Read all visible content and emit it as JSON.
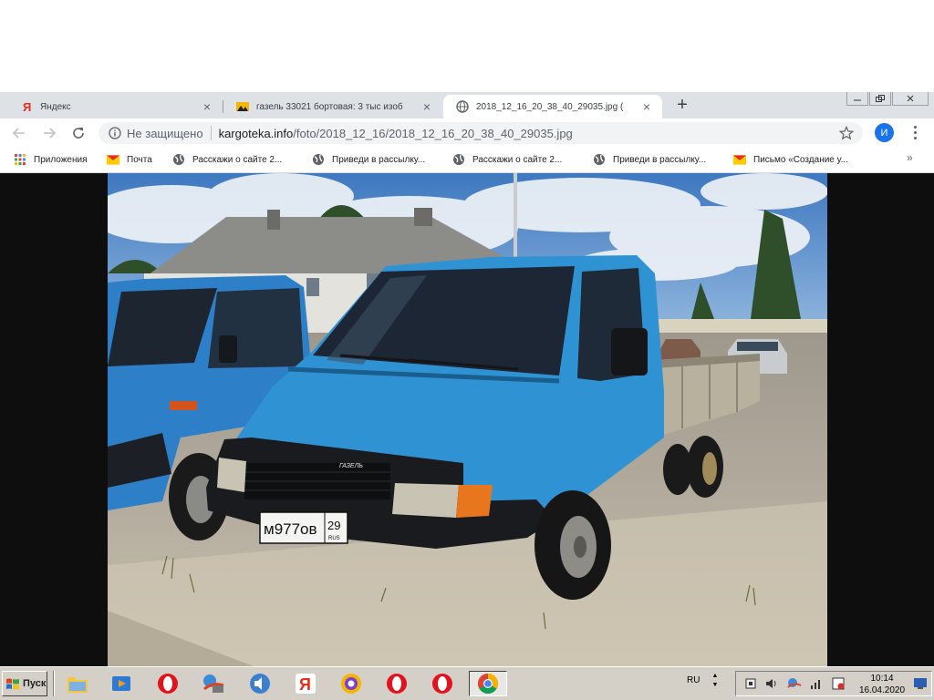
{
  "browser": {
    "tabs": [
      {
        "title": "Яндекс",
        "icon": "yandex-icon"
      },
      {
        "title": "газель 33021 бортовая: 3 тыс изоб",
        "icon": "image-site-icon"
      },
      {
        "title": "2018_12_16_20_38_40_29035.jpg (",
        "icon": "globe-icon"
      }
    ],
    "new_tab": "+",
    "security_label": "Не защищено",
    "url_host": "kargoteka.info",
    "url_path": "/foto/2018_12_16/2018_12_16_20_38_40_29035.jpg",
    "profile_initial": "И",
    "bookmarks": [
      {
        "label": "Приложения",
        "icon": "apps-grid-icon"
      },
      {
        "label": "Почта",
        "icon": "mail-icon"
      },
      {
        "label": "Расскажи о сайте 2...",
        "icon": "globe-icon"
      },
      {
        "label": "Приведи в рассылку...",
        "icon": "globe-icon"
      },
      {
        "label": "Расскажи о сайте 2...",
        "icon": "globe-icon"
      },
      {
        "label": "Приведи в рассылку...",
        "icon": "globe-icon"
      },
      {
        "label": "Письмо «Создание у...",
        "icon": "mail-icon"
      }
    ],
    "bookmarks_overflow": "»"
  },
  "photo": {
    "plate_number": "м977ов",
    "plate_region": "29",
    "plate_country": "RUS",
    "grille_badge": "ГАЗЕЛЬ"
  },
  "taskbar": {
    "start_label": "Пуск",
    "quick_launch": [
      "folder-icon",
      "media-player-icon",
      "opera-icon",
      "network-icon",
      "sound-icon",
      "yandex-browser-icon",
      "search-browser-icon",
      "opera-icon",
      "opera-icon",
      "chrome-icon"
    ],
    "language": "RU",
    "time": "10:14",
    "date": "16.04.2020"
  },
  "colors": {
    "tabstrip": "#dee1e6",
    "accent_blue": "#1a73e8",
    "truck_blue": "#2f93d3",
    "taskbar": "#d4d0c8"
  }
}
